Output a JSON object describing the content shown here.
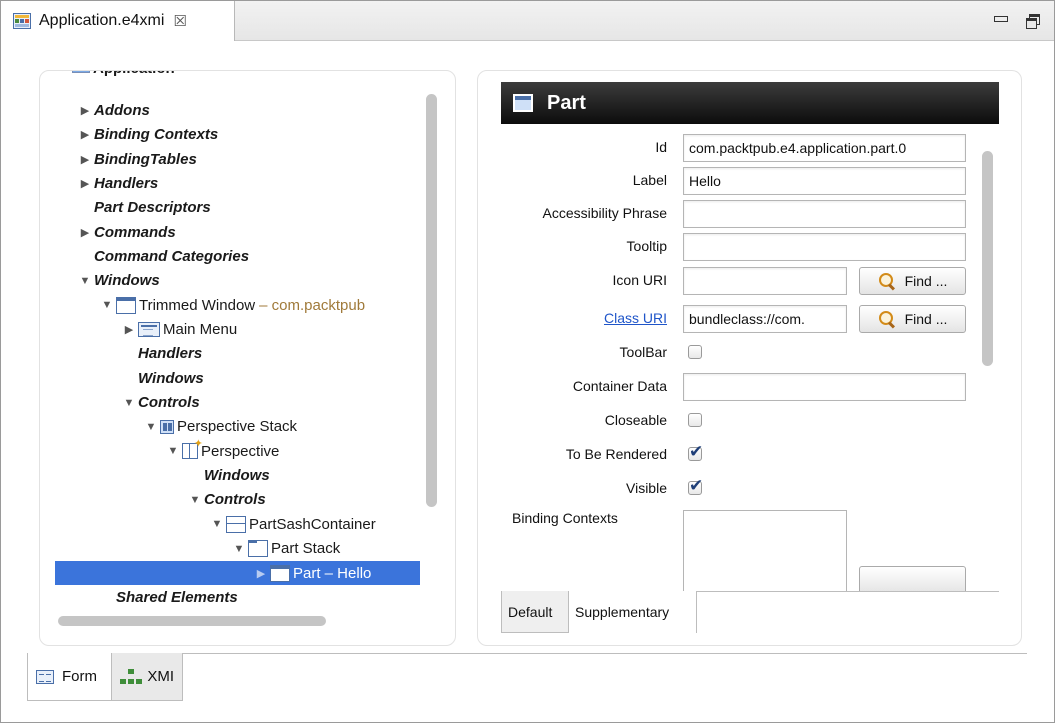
{
  "editor": {
    "tab_title": "Application.e4xmi",
    "close_glyph": "☒",
    "icons": {
      "tab": "application-model-icon",
      "close": "close-icon",
      "minimize": "minimize-icon",
      "restore": "restore-icon"
    }
  },
  "tree": {
    "items": [
      {
        "label": "Application",
        "depth": 0,
        "arrow": "▼",
        "italic": false,
        "bold": true,
        "icon": "application-icon",
        "partial": true
      },
      {
        "label": "Addons",
        "depth": 1,
        "arrow": "▶",
        "italic": true
      },
      {
        "label": "Binding Contexts",
        "depth": 1,
        "arrow": "▶",
        "italic": true
      },
      {
        "label": "BindingTables",
        "depth": 1,
        "arrow": "▶",
        "italic": true
      },
      {
        "label": "Handlers",
        "depth": 1,
        "arrow": "▶",
        "italic": true
      },
      {
        "label": "Part Descriptors",
        "depth": 1,
        "arrow": "",
        "italic": true
      },
      {
        "label": "Commands",
        "depth": 1,
        "arrow": "▶",
        "italic": true
      },
      {
        "label": "Command Categories",
        "depth": 1,
        "arrow": "",
        "italic": true
      },
      {
        "label": "Windows",
        "depth": 1,
        "arrow": "▼",
        "italic": true
      },
      {
        "label": "Trimmed Window",
        "suffix": "– com.packtpub",
        "depth": 2,
        "arrow": "▼",
        "italic": false,
        "icon": "window-icon"
      },
      {
        "label": "Main Menu",
        "depth": 3,
        "arrow": "▶",
        "italic": false,
        "icon": "menu-icon"
      },
      {
        "label": "Handlers",
        "depth": 3,
        "arrow": "",
        "italic": true
      },
      {
        "label": "Windows",
        "depth": 3,
        "arrow": "",
        "italic": true
      },
      {
        "label": "Controls",
        "depth": 3,
        "arrow": "▼",
        "italic": true
      },
      {
        "label": "Perspective Stack",
        "depth": 4,
        "arrow": "▼",
        "italic": false,
        "icon": "perspective-stack-icon"
      },
      {
        "label": "Perspective",
        "depth": 5,
        "arrow": "▼",
        "italic": false,
        "icon": "perspective-icon"
      },
      {
        "label": "Windows",
        "depth": 6,
        "arrow": "",
        "italic": true
      },
      {
        "label": "Controls",
        "depth": 6,
        "arrow": "▼",
        "italic": true
      },
      {
        "label": "PartSashContainer",
        "depth": 7,
        "arrow": "▼",
        "italic": false,
        "icon": "sash-container-icon"
      },
      {
        "label": "Part Stack",
        "depth": 8,
        "arrow": "▼",
        "italic": false,
        "icon": "part-stack-icon"
      },
      {
        "label": "Part – Hello",
        "depth": 9,
        "arrow": "▶",
        "italic": false,
        "icon": "part-icon",
        "selected": true
      },
      {
        "label": "Shared Elements",
        "depth": 2,
        "arrow": "",
        "italic": true
      }
    ]
  },
  "detail": {
    "header_title": "Part",
    "fields": {
      "id": {
        "label": "Id",
        "value": "com.packtpub.e4.application.part.0"
      },
      "label": {
        "label": "Label",
        "value": "Hello"
      },
      "accessibility": {
        "label": "Accessibility Phrase",
        "value": ""
      },
      "tooltip": {
        "label": "Tooltip",
        "value": ""
      },
      "icon_uri": {
        "label": "Icon URI",
        "value": "",
        "button": "Find ..."
      },
      "class_uri": {
        "label": "Class URI",
        "value": "bundleclass://com.",
        "button": "Find ..."
      },
      "toolbar": {
        "label": "ToolBar",
        "checked": false
      },
      "container_data": {
        "label": "Container Data",
        "value": ""
      },
      "closeable": {
        "label": "Closeable",
        "checked": false
      },
      "to_be_rendered": {
        "label": "To Be Rendered",
        "checked": true
      },
      "visible": {
        "label": "Visible",
        "checked": true
      },
      "binding_contexts": {
        "label": "Binding Contexts"
      }
    },
    "tabs": [
      {
        "label": "Default",
        "active": false
      },
      {
        "label": "Supplementary",
        "active": true
      }
    ]
  },
  "bottom_tabs": [
    {
      "label": "Form",
      "icon": "form-icon",
      "active": true
    },
    {
      "label": "XMI",
      "icon": "xmi-tree-icon",
      "active": false
    }
  ],
  "colors": {
    "selection": "#3b74db",
    "header": "#1a1a1a",
    "link": "#1f55c9",
    "suffix": "#a07a3a"
  }
}
